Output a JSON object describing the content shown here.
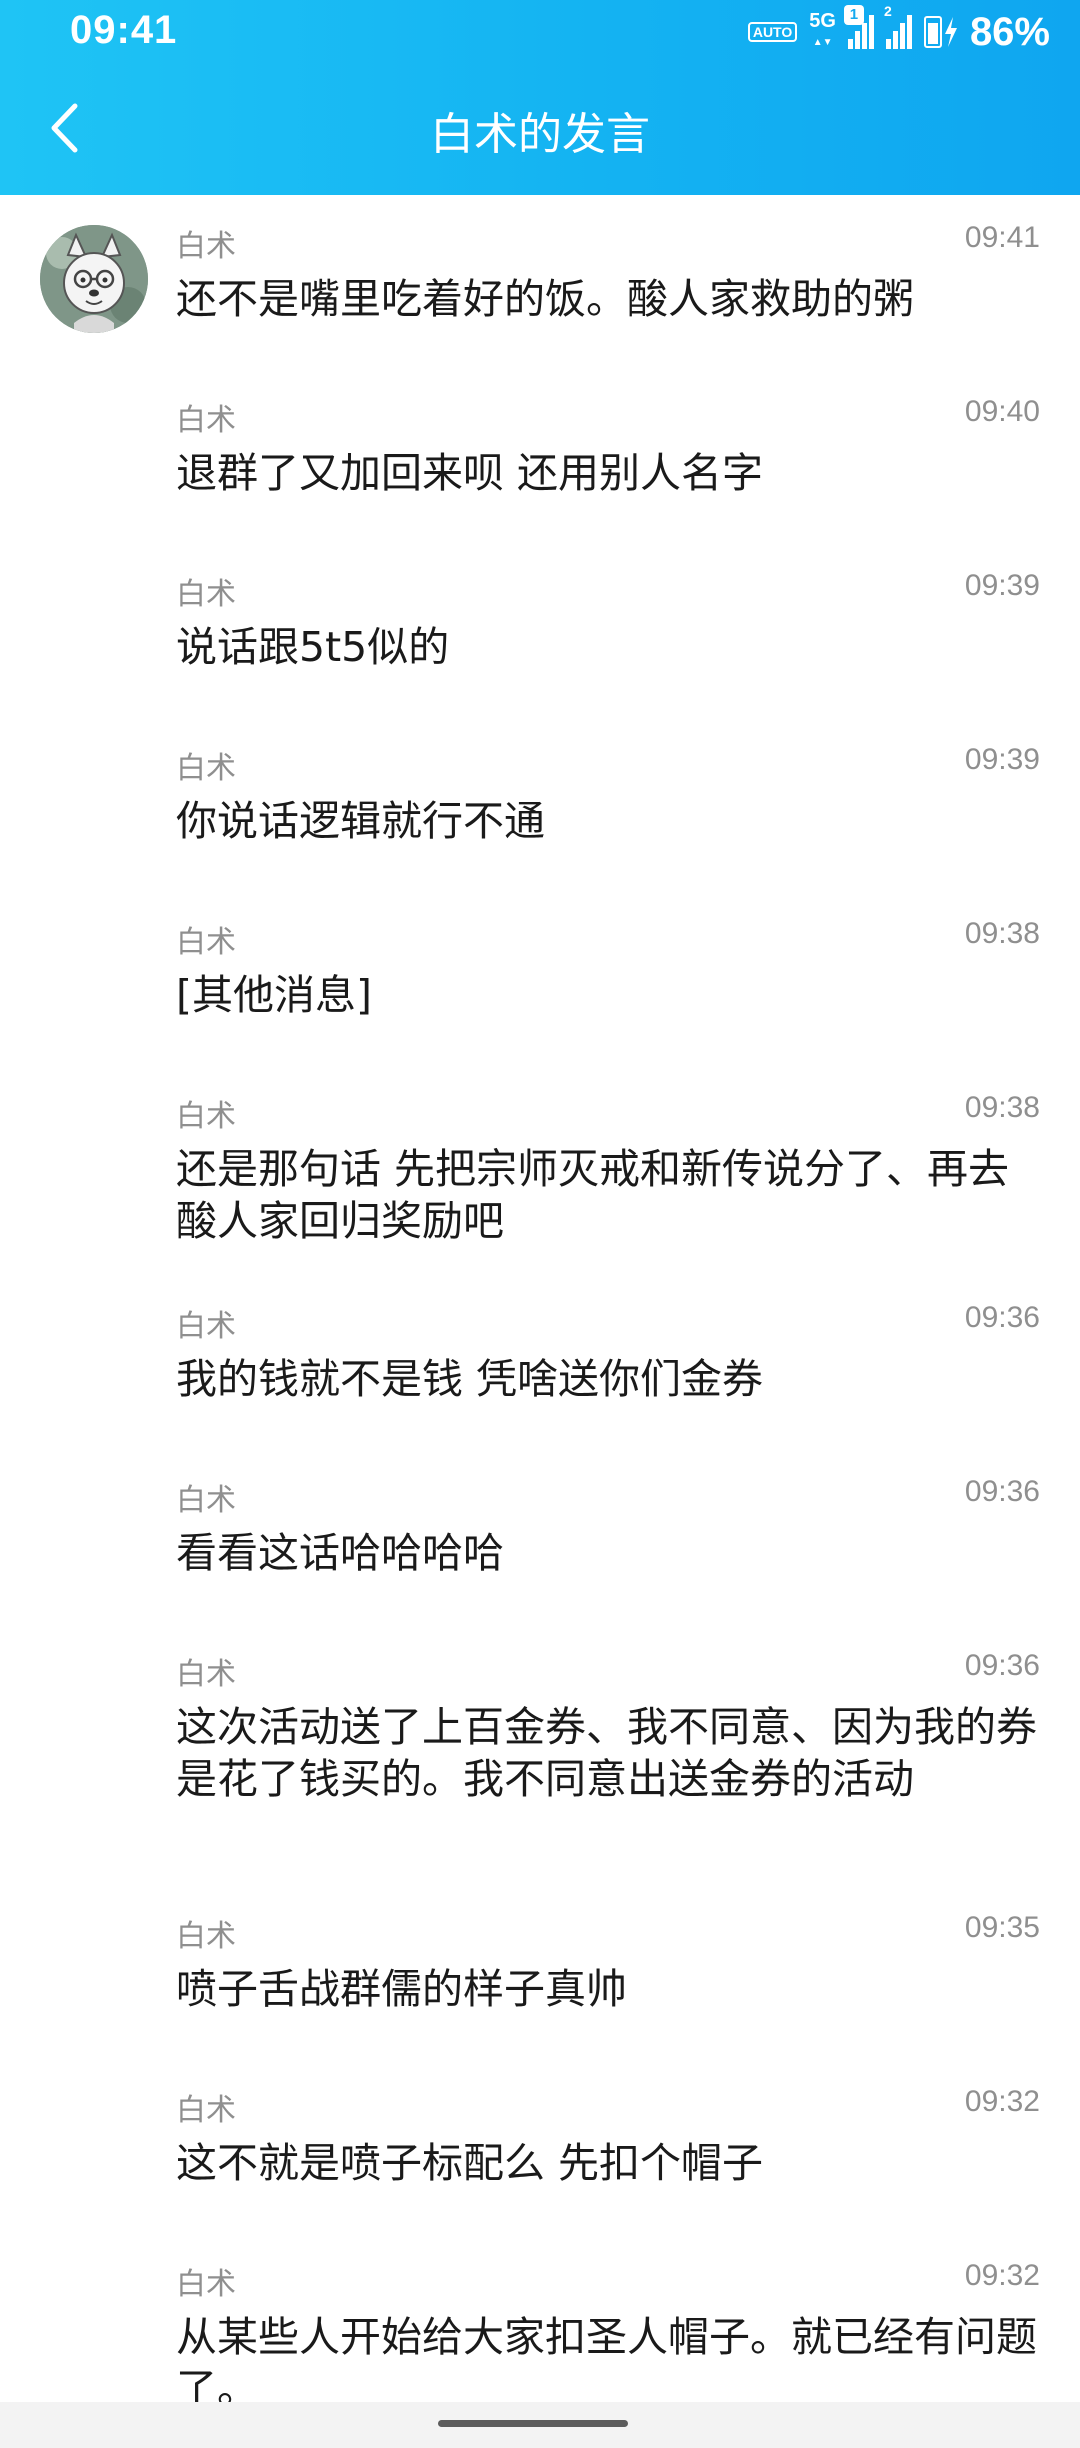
{
  "status": {
    "time": "09:41",
    "auto_label": "AUTO",
    "net_label": "5G",
    "sim1_badge": "1",
    "sim2_badge": "2",
    "battery": "86%"
  },
  "header": {
    "title": "白术的发言",
    "back_icon": "chevron-left-icon",
    "gradient": [
      "#1fc4f5",
      "#0fa6f0"
    ]
  },
  "messages": [
    {
      "sender": "白术",
      "time": "09:41",
      "text": "还不是嘴里吃着好的饭。酸人家救助的粥",
      "avatar": true
    },
    {
      "sender": "白术",
      "time": "09:40",
      "text": "退群了又加回来呗 还用别人名字"
    },
    {
      "sender": "白术",
      "time": "09:39",
      "text": "说话跟5t5似的"
    },
    {
      "sender": "白术",
      "time": "09:39",
      "text": "你说话逻辑就行不通"
    },
    {
      "sender": "白术",
      "time": "09:38",
      "text": "[其他消息]"
    },
    {
      "sender": "白术",
      "time": "09:38",
      "text": "还是那句话 先把宗师灭戒和新传说分了、再去酸人家回归奖励吧"
    },
    {
      "sender": "白术",
      "time": "09:36",
      "text": "我的钱就不是钱 凭啥送你们金券"
    },
    {
      "sender": "白术",
      "time": "09:36",
      "text": "看看这话哈哈哈哈"
    },
    {
      "sender": "白术",
      "time": "09:36",
      "text": "这次活动送了上百金券、我不同意、因为我的券是花了钱买的。我不同意出送金券的活动"
    },
    {
      "sender": "白术",
      "time": "09:35",
      "text": "喷子舌战群儒的样子真帅"
    },
    {
      "sender": "白术",
      "time": "09:32",
      "text": "这不就是喷子标配么 先扣个帽子"
    },
    {
      "sender": "白术",
      "time": "09:32",
      "text": "从某些人开始给大家扣圣人帽子。就已经有问题了。"
    }
  ]
}
